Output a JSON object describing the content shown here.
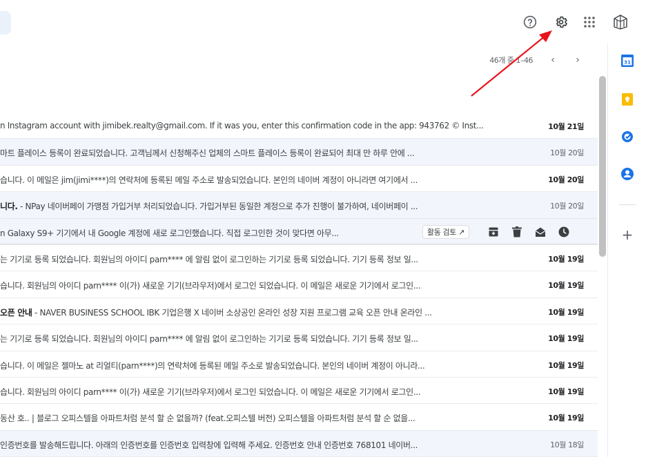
{
  "pager": {
    "range_text": "46개 중 1–46",
    "prev": "‹",
    "next": "›"
  },
  "emails": [
    {
      "snippet": "n Instagram account with jimibek.realty@gmail.com. If it was you, enter this confirmation code in the app: 943762 © Inst...",
      "date": "10월 21일",
      "bold_date": true,
      "read": false
    },
    {
      "snippet": "마트 플레이스 등록이 완료되었습니다. 고객님께서 신청해주신 업체의 스마트 플레이스 등록이 완료되어 최대 만 하루 안에 ...",
      "date": "10월 20일",
      "bold_date": false,
      "read": true
    },
    {
      "snippet": "습니다. 이 메일은 jim(jimi****)의 연락처에 등록된 메일 주소로 발송되었습니다. 본인의 네이버 계정이 아니라면 여기에서 ...",
      "date": "10월 20일",
      "bold_date": true,
      "read": false
    },
    {
      "bold": "니다.",
      "snippet": " - NPay 네이버페이 가맹점 가입거부 처리되었습니다. 가입거부된 동일한 계정으로 추가 진행이 불가하여, 네이버페이 ...",
      "date": "10월 20일",
      "bold_date": false,
      "read": true
    },
    {
      "snippet": "n Galaxy S9+ 기기에서 내 Google 계정에 새로 로그인했습니다. 직접 로그인한 것이 맞다면 아무...",
      "review_label": "활동 검토 ↗",
      "hover": true
    },
    {
      "snippet": "는 기기로 등록 되었습니다. 회원님의 아이디 parn**** 에 알림 없이 로그인하는 기기로 등록 되었습니다. 기기 등록 정보 일...",
      "date": "10월 19일",
      "bold_date": true,
      "read": false
    },
    {
      "snippet": "습니다. 회원님의 아이디 parn**** 이(가) 새로운 기기(브라우저)에서 로그인 되었습니다. 이 메일은 새로운 기기에서 로그인...",
      "date": "10월 19일",
      "bold_date": true,
      "read": false
    },
    {
      "bold": "오픈 안내",
      "snippet": " - NAVER BUSINESS SCHOOL IBK 기업은행 X 네이버 소상공인 온라인 성장 지원 프로그램 교육 오픈 안내 온라인 ...",
      "date": "10월 19일",
      "bold_date": true,
      "read": false
    },
    {
      "snippet": "는 기기로 등록 되었습니다. 회원님의 아이디 parn**** 에 알림 없이 로그인하는 기기로 등록 되었습니다. 기기 등록 정보 일...",
      "date": "10월 19일",
      "bold_date": true,
      "read": false
    },
    {
      "snippet": "습니다. 이 메일은 젤마노 at 리얼티(parn****)의 연락처에 등록된 메일 주소로 발송되었습니다. 본인의 네이버 계정이 아니라...",
      "date": "10월 19일",
      "bold_date": true,
      "read": false
    },
    {
      "snippet": "습니다. 회원님의 아이디 parn**** 이(가) 새로운 기기(브라우저)에서 로그인 되었습니다. 이 메일은 새로운 기기에서 로그인...",
      "date": "10월 19일",
      "bold_date": true,
      "read": false
    },
    {
      "snippet": "동산 호.. | 블로그 오피스텔을 아파트처럼 분석 할 순 없을까? (feat.오피스텔 버전) 오피스텔을 아파트처럼 분석 할 순 없을...",
      "date": "10월 19일",
      "bold_date": true,
      "read": false
    },
    {
      "snippet": "인증번호를 발송해드립니다. 아래의 인증번호를 인증번호 입력창에 입력해 주세요. 인증번호 안내 인증번호 768101 네이버...",
      "date": "10월 18일",
      "bold_date": false,
      "read": true
    }
  ],
  "side_panel": {
    "calendar_day": "31",
    "add": "+"
  },
  "colors": {
    "accent_blue": "#1a73e8",
    "keep_yellow": "#fbbc04",
    "arrow_red": "#e8121c"
  }
}
